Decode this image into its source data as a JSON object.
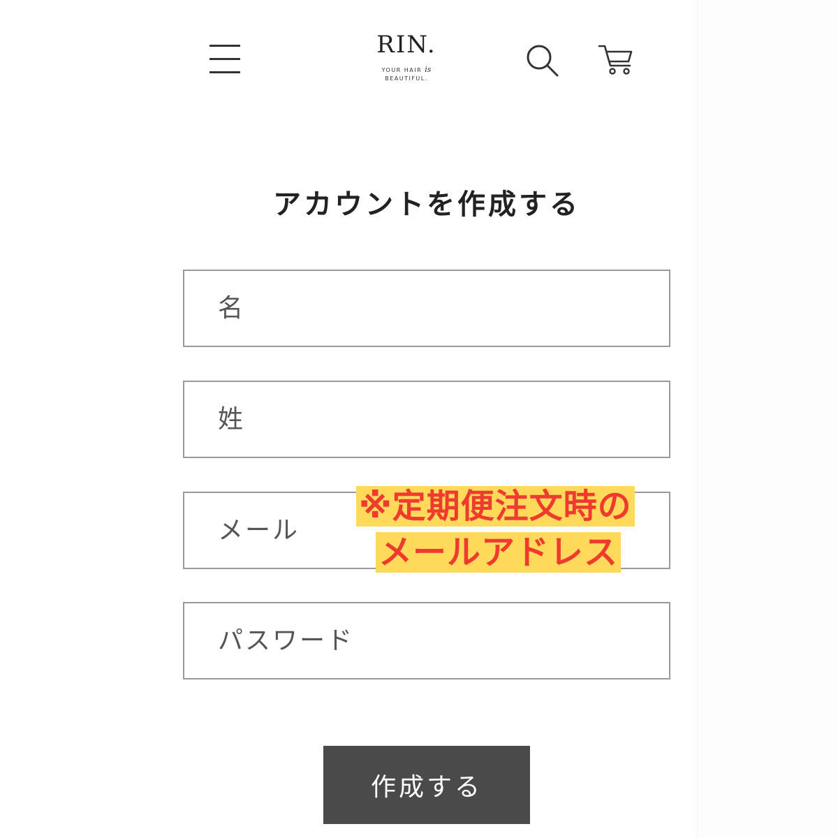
{
  "header": {
    "menu_icon": "hamburger-menu-icon",
    "logo": {
      "main": "RIN.",
      "tagline_prefix": "YOUR HAIR",
      "tagline_script": "is",
      "tagline_suffix": "BEAUTIFUL."
    },
    "search_icon": "search-icon",
    "cart_icon": "cart-icon"
  },
  "form": {
    "title": "アカウントを作成する",
    "fields": {
      "first_name": {
        "placeholder": "名",
        "value": ""
      },
      "last_name": {
        "placeholder": "姓",
        "value": ""
      },
      "email": {
        "placeholder": "メール",
        "value": ""
      },
      "password": {
        "placeholder": "パスワード",
        "value": ""
      }
    },
    "submit_label": "作成する"
  },
  "annotation": {
    "line1": "※定期便注文時の",
    "line2": "メールアドレス",
    "text_color": "#ef3b2f",
    "highlight_color": "#ffd95a"
  },
  "colors": {
    "button_bg": "#4a4a4a",
    "field_border": "#9a9a9a",
    "text": "#222222"
  }
}
